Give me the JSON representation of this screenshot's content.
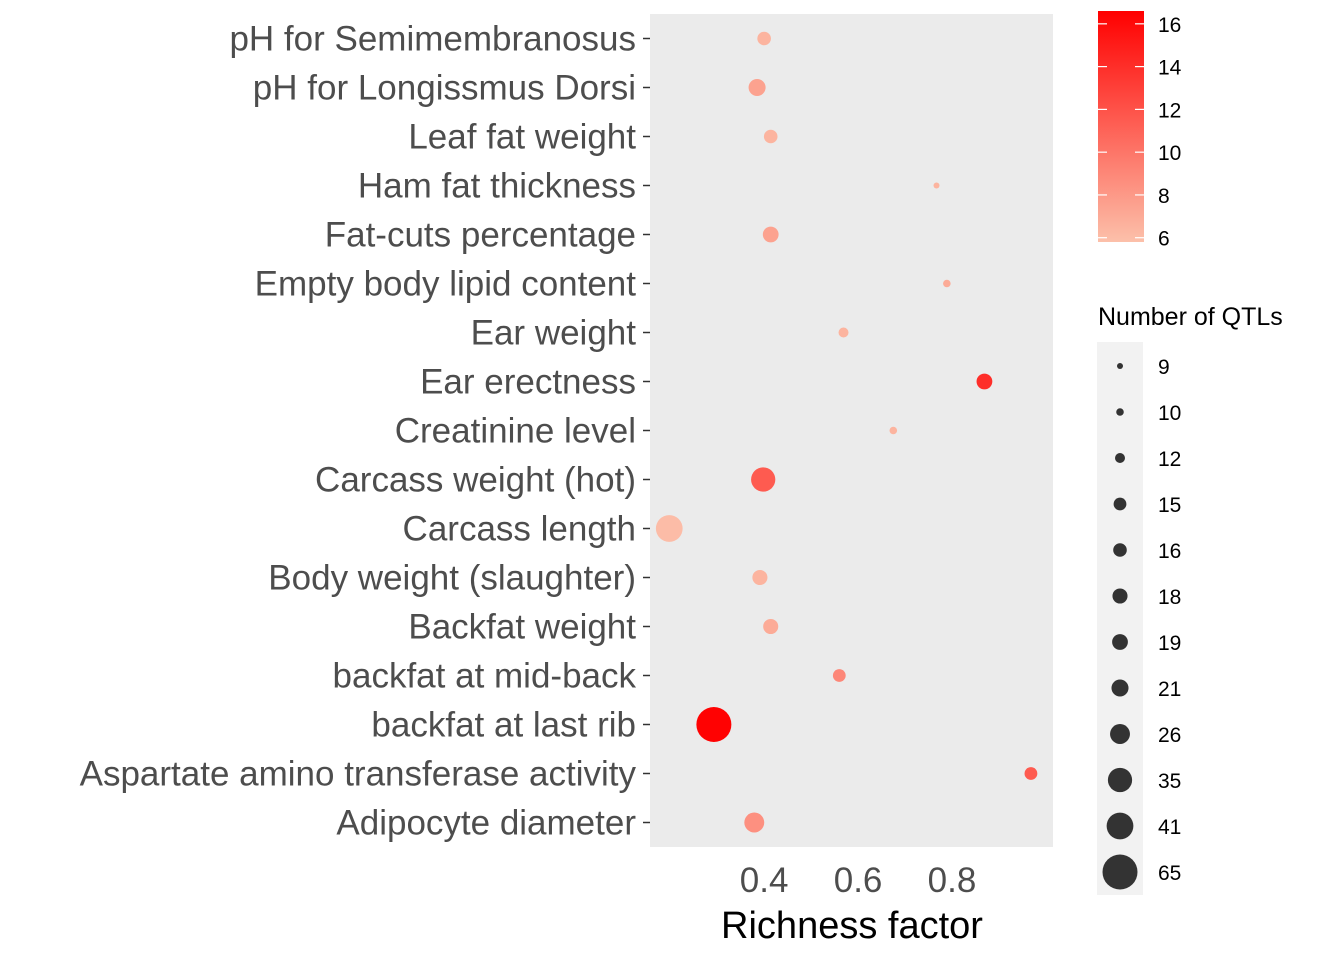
{
  "chart_data": {
    "type": "scatter",
    "title": "",
    "xlabel": "Richness factor",
    "ylabel": "",
    "xlim": [
      0.157,
      1.015
    ],
    "x_ticks": [
      0.4,
      0.6,
      0.8
    ],
    "x_tick_labels": [
      "0.4",
      "0.6",
      "0.8"
    ],
    "grid": false,
    "panel_background": "#EBEBEB",
    "categories": [
      "pH for Semimembranosus",
      "pH for Longissmus Dorsi",
      "Leaf fat weight",
      "Ham fat thickness",
      "Fat-cuts percentage",
      "Empty body lipid content",
      "Ear weight",
      "Ear erectness",
      "Creatinine level",
      "Carcass weight (hot)",
      "Carcass length",
      "Body weight (slaughter)",
      "Backfat weight",
      "backfat at mid-back",
      "backfat at last rib",
      "Aspartate amino transferase activity",
      "Adipocyte diameter"
    ],
    "points": [
      {
        "category": "pH for Semimembranosus",
        "x": 0.4,
        "count": 16,
        "color_value": 6.5
      },
      {
        "category": "pH for Longissmus Dorsi",
        "x": 0.385,
        "count": 21,
        "color_value": 7.5
      },
      {
        "category": "Leaf fat weight",
        "x": 0.414,
        "count": 16,
        "color_value": 6.5
      },
      {
        "category": "Ham fat thickness",
        "x": 0.767,
        "count": 9,
        "color_value": 6.5
      },
      {
        "category": "Fat-cuts percentage",
        "x": 0.414,
        "count": 19,
        "color_value": 7.5
      },
      {
        "category": "Empty body lipid content",
        "x": 0.789,
        "count": 10,
        "color_value": 7.0
      },
      {
        "category": "Ear weight",
        "x": 0.569,
        "count": 12,
        "color_value": 6.5
      },
      {
        "category": "Ear erectness",
        "x": 0.869,
        "count": 19,
        "color_value": 14.0
      },
      {
        "category": "Creatinine level",
        "x": 0.675,
        "count": 10,
        "color_value": 6.5
      },
      {
        "category": "Carcass weight (hot)",
        "x": 0.398,
        "count": 35,
        "color_value": 11.5
      },
      {
        "category": "Carcass length",
        "x": 0.198,
        "count": 41,
        "color_value": 6.0
      },
      {
        "category": "Body weight (slaughter)",
        "x": 0.391,
        "count": 18,
        "color_value": 6.5
      },
      {
        "category": "Backfat weight",
        "x": 0.414,
        "count": 18,
        "color_value": 7.0
      },
      {
        "category": "backfat at mid-back",
        "x": 0.56,
        "count": 15,
        "color_value": 9.0
      },
      {
        "category": "backfat at last rib",
        "x": 0.293,
        "count": 65,
        "color_value": 16.5
      },
      {
        "category": "Aspartate amino transferase activity",
        "x": 0.968,
        "count": 15,
        "color_value": 11.5
      },
      {
        "category": "Adipocyte diameter",
        "x": 0.379,
        "count": 26,
        "color_value": 8.5
      }
    ],
    "color_legend": {
      "title": "",
      "ticks": [
        6,
        8,
        10,
        12,
        14,
        16
      ],
      "range": [
        5.8,
        16.6
      ],
      "low_color": "#FCC0AA",
      "high_color": "#FF0000"
    },
    "size_legend": {
      "title": "Number of QTLs",
      "breaks": [
        9,
        10,
        12,
        15,
        16,
        18,
        19,
        21,
        26,
        35,
        41,
        65
      ],
      "key_color": "#333333"
    }
  }
}
